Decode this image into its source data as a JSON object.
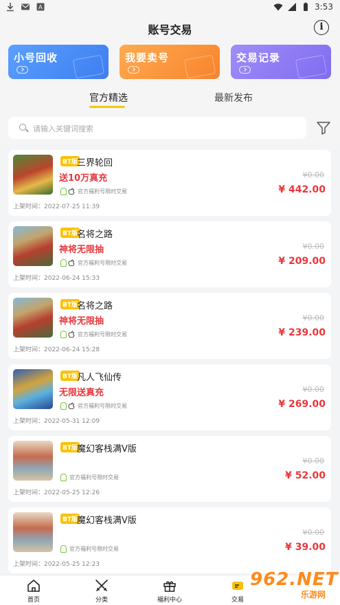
{
  "status_bar": {
    "time": "3:53"
  },
  "header": {
    "title": "账号交易"
  },
  "action_cards": [
    {
      "label": "小号回收",
      "color": "#4d8ff6"
    },
    {
      "label": "我要卖号",
      "color": "#f98e3f"
    },
    {
      "label": "交易记录",
      "color": "#8f7cf4"
    }
  ],
  "tabs": [
    {
      "label": "官方精选",
      "active": true
    },
    {
      "label": "最新发布",
      "active": false
    }
  ],
  "search": {
    "placeholder": "请输入关键词搜索"
  },
  "items": [
    {
      "tag": "BT版",
      "name": "三界轮回",
      "slogan": "送10万真充",
      "platforms": [
        "android",
        "apple"
      ],
      "platform_text": "官方福利号限时交易",
      "orig_price": "¥0.00",
      "price": "¥ 442.00",
      "listed": "上架时间：2022-07-25 11:39"
    },
    {
      "tag": "BT版",
      "name": "名将之路",
      "slogan": "神将无限抽",
      "platforms": [
        "android",
        "apple"
      ],
      "platform_text": "官方福利号限时交易",
      "orig_price": "¥0.00",
      "price": "¥ 209.00",
      "listed": "上架时间：2022-06-24 15:33"
    },
    {
      "tag": "BT版",
      "name": "名将之路",
      "slogan": "神将无限抽",
      "platforms": [
        "android",
        "apple"
      ],
      "platform_text": "官方福利号限时交易",
      "orig_price": "¥0.00",
      "price": "¥ 239.00",
      "listed": "上架时间：2022-06-24 15:28"
    },
    {
      "tag": "BT版",
      "name": "凡人飞仙传",
      "slogan": "无限送真充",
      "platforms": [
        "android",
        "apple"
      ],
      "platform_text": "官方福利号限时交易",
      "orig_price": "¥0.00",
      "price": "¥ 269.00",
      "listed": "上架时间：2022-05-31 12:09"
    },
    {
      "tag": "BT版",
      "name": "魔幻客栈满V版",
      "slogan": "",
      "platforms": [
        "android"
      ],
      "platform_text": "官方福利号限时交易",
      "orig_price": "¥0.00",
      "price": "¥ 52.00",
      "listed": "上架时间：2022-05-25 12:26"
    },
    {
      "tag": "BT版",
      "name": "魔幻客栈满V版",
      "slogan": "",
      "platforms": [
        "android"
      ],
      "platform_text": "官方福利号限时交易",
      "orig_price": "¥0.00",
      "price": "¥ 39.00",
      "listed": "上架时间：2022-05-25 12:23"
    }
  ],
  "bottom_nav": [
    {
      "label": "首页",
      "icon": "home-icon"
    },
    {
      "label": "分类",
      "icon": "swords-icon"
    },
    {
      "label": "福利中心",
      "icon": "gift-icon"
    },
    {
      "label": "交易",
      "icon": "trade-icon"
    }
  ],
  "watermark": {
    "big": "962.NET",
    "small": "乐游网"
  }
}
